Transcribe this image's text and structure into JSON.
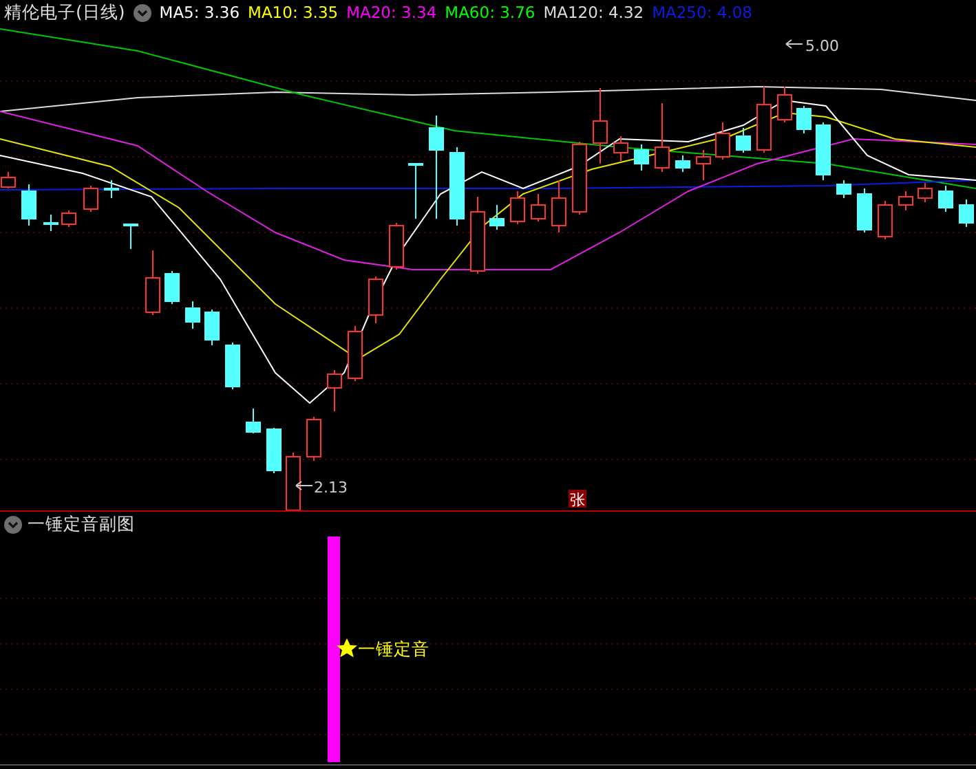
{
  "window": {
    "title": "精伦电子(日线)"
  },
  "ma_legend": [
    {
      "label": "MA5: 3.36",
      "color": "#ffffff"
    },
    {
      "label": "MA10: 3.35",
      "color": "#ffff00"
    },
    {
      "label": "MA20: 3.34",
      "color": "#ff00ff"
    },
    {
      "label": "MA60: 3.76",
      "color": "#00ff00"
    },
    {
      "label": "MA120: 4.32",
      "color": "#dcdcdc"
    },
    {
      "label": "MA250: 4.08",
      "color": "#0a1ee6"
    }
  ],
  "annotations": [
    {
      "kind": "high",
      "label": "5.00"
    },
    {
      "kind": "low",
      "label": "2.13"
    }
  ],
  "badge": {
    "label": "张"
  },
  "sub_panel": {
    "title": "一锤定音副图",
    "signal_label": "一锤定音"
  }
}
